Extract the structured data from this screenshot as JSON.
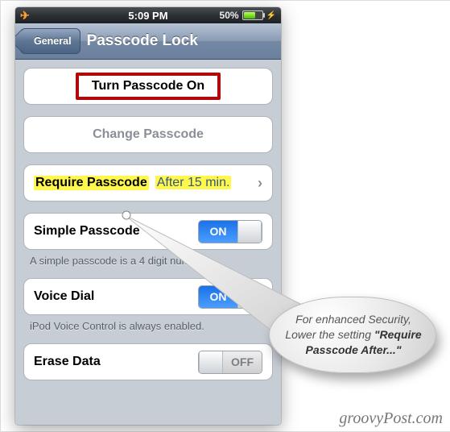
{
  "statusbar": {
    "time": "5:09 PM",
    "battery_percent": "50%"
  },
  "nav": {
    "back_label": "General",
    "title": "Passcode Lock"
  },
  "cells": {
    "turn_on": "Turn Passcode On",
    "change": "Change Passcode",
    "require_label": "Require Passcode",
    "require_value": "After 15 min.",
    "simple_label": "Simple Passcode",
    "simple_help": "A simple passcode is a 4 digit number.",
    "voice_label": "Voice Dial",
    "voice_help": "iPod Voice Control is always enabled.",
    "erase_label": "Erase Data"
  },
  "toggles": {
    "on_label": "ON",
    "off_label": "OFF",
    "simple_state": "on",
    "voice_state": "on",
    "erase_state": "off"
  },
  "callout": {
    "line1": "For enhanced Security, Lower the setting ",
    "bold": "\"Require Passcode After...\""
  },
  "watermark": "groovyPost.com"
}
